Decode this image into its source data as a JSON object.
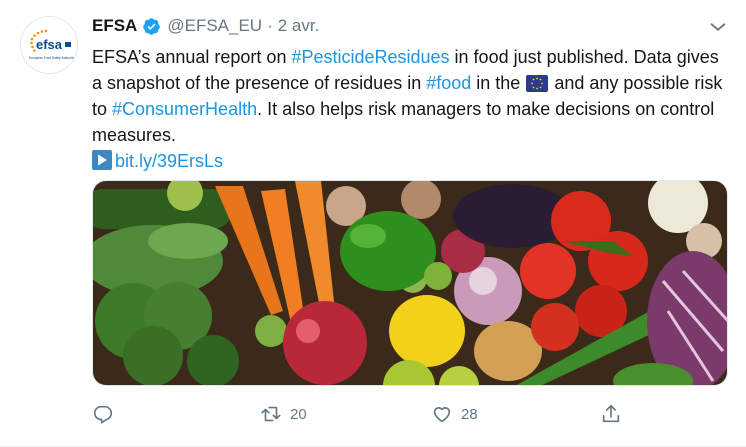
{
  "tweet": {
    "author_name": "EFSA",
    "handle": "@EFSA_EU",
    "separator": "·",
    "date": "2 avr.",
    "avatar_logo_text": "efsa",
    "avatar_logo_subtitle": "European Food Safety Authority",
    "text": {
      "t1": "EFSA’s annual report on ",
      "tag1": "#PesticideResidues",
      "t2": " in food just published. Data gives a snapshot of the presence of residues in ",
      "tag2": "#food",
      "t3": " in the ",
      "flag": "eu-flag-icon",
      "t4": " and any possible risk to ",
      "tag3": "#ConsumerHealth",
      "t5": ". It also helps risk managers to make decisions on control measures.",
      "link": "bit.ly/39ErsLs"
    },
    "media_alt": "vegetables and fruits photo",
    "actions": {
      "reply_count": "",
      "retweet_count": "20",
      "like_count": "28"
    },
    "colors": {
      "link": "#1b95e0",
      "secondary": "#657786",
      "verified": "#1da1f2"
    }
  }
}
